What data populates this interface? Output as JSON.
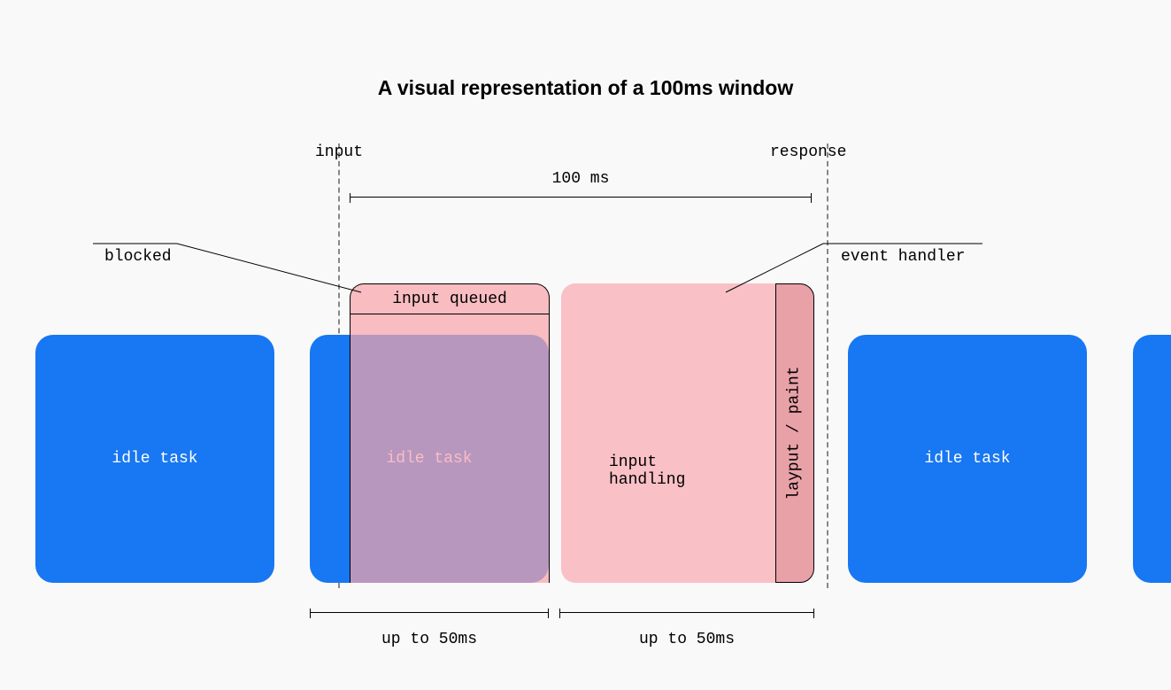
{
  "title": "A visual representation of a 100ms window",
  "markers": {
    "input_label": "input",
    "response_label": "response",
    "window_label": "100 ms"
  },
  "blocks": {
    "idle_task_label": "idle task",
    "input_queued_label": "input queued",
    "input_handling_label": "input\nhandling",
    "layout_paint_label": "layput / paint"
  },
  "callouts": {
    "blocked_label": "blocked",
    "event_handler_label": "event handler"
  },
  "bottom_brackets": {
    "left_label": "up to 50ms",
    "right_label": "up to 50ms"
  },
  "chart_data": {
    "type": "timeline",
    "window_ms": 100,
    "annotations": [
      "input",
      "response"
    ],
    "segments": [
      {
        "name": "idle task (blocked)",
        "max_ms": 50,
        "role": "blocked-by-idle"
      },
      {
        "name": "input queued",
        "overlaps": "idle task (blocked)"
      },
      {
        "name": "input handling + layout/paint",
        "max_ms": 50,
        "role": "event-handler"
      }
    ],
    "lanes": [
      "idle task",
      "idle task",
      "input handling",
      "idle task",
      "idle task"
    ]
  }
}
